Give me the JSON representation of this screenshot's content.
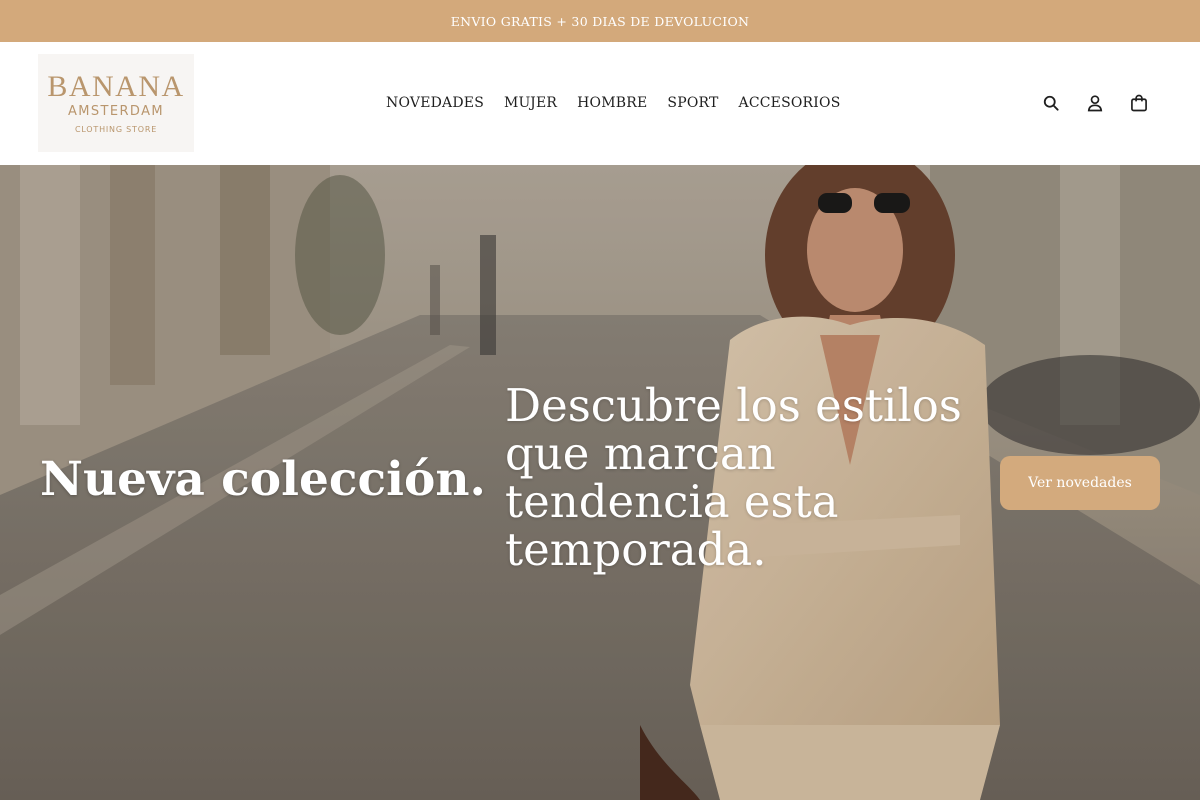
{
  "announcement": {
    "text": "ENVIO GRATIS + 30 DIAS DE DEVOLUCION"
  },
  "brand": {
    "name": "BANANA",
    "city": "AMSTERDAM",
    "tagline": "CLOTHING STORE",
    "color": "#b9966d"
  },
  "nav": {
    "items": [
      {
        "label": "NOVEDADES"
      },
      {
        "label": "MUJER"
      },
      {
        "label": "HOMBRE"
      },
      {
        "label": "SPORT"
      },
      {
        "label": "ACCESORIOS"
      }
    ]
  },
  "header_icons": [
    {
      "icon": "search-icon"
    },
    {
      "icon": "account-icon"
    },
    {
      "icon": "shopping-bag-icon"
    }
  ],
  "hero": {
    "title": "Nueva colección.",
    "subtitle": "Descubre los estilos que marcan tendencia esta temporada.",
    "button_label": "Ver novedades"
  },
  "colors": {
    "accent": "#d3a97b",
    "text": "#1f1f1f",
    "white": "#ffffff"
  }
}
